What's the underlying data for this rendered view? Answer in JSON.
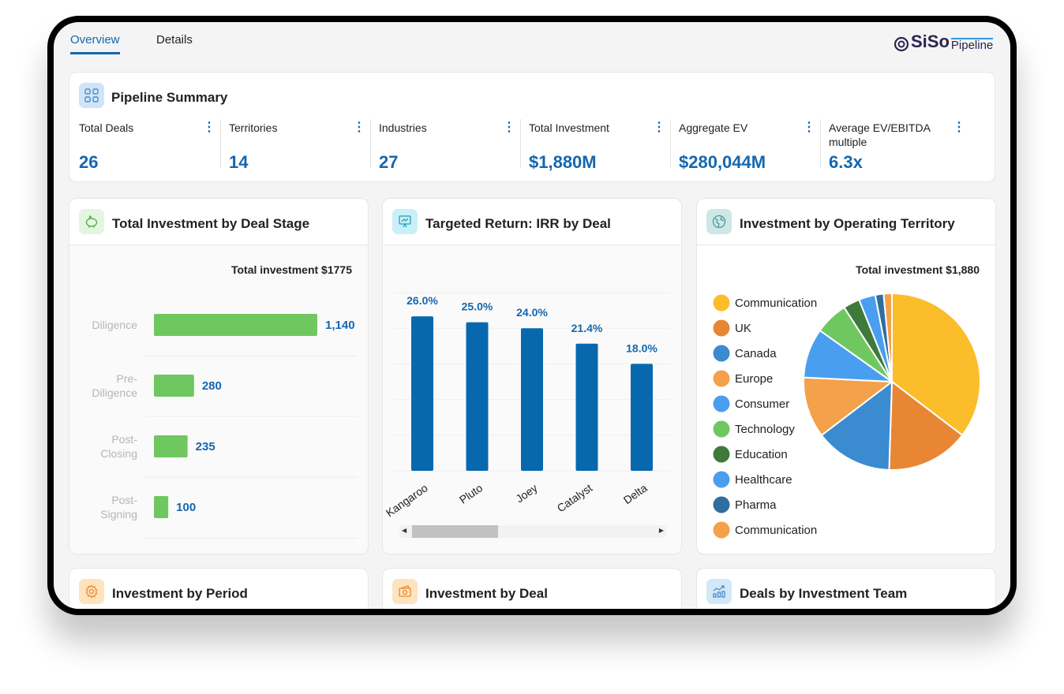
{
  "tabs": [
    {
      "label": "Overview",
      "active": true
    },
    {
      "label": "Details",
      "active": false
    }
  ],
  "logo": {
    "brand": "SiSo",
    "product": "Pipeline"
  },
  "summary": {
    "title": "Pipeline Summary",
    "metrics": [
      {
        "label": "Total Deals",
        "value": "26"
      },
      {
        "label": "Territories",
        "value": "14"
      },
      {
        "label": "Industries",
        "value": "27"
      },
      {
        "label": "Total Investment",
        "value": "$1,880M"
      },
      {
        "label": "Aggregate EV",
        "value": "$280,044M"
      },
      {
        "label": "Average EV/EBITDA multiple",
        "value": "6.3x"
      }
    ]
  },
  "cards": {
    "deal_stage": {
      "title": "Total Investment by Deal Stage",
      "icon": "piggy-bank-icon"
    },
    "irr": {
      "title": "Targeted Return: IRR by Deal",
      "icon": "presentation-chart-icon"
    },
    "territory": {
      "title": "Investment by Operating Territory",
      "icon": "globe-icon"
    },
    "period": {
      "title": "Investment by Period",
      "icon": "gear-icon"
    },
    "deal": {
      "title": "Investment by Deal",
      "icon": "cash-icon"
    },
    "team": {
      "title": "Deals by Investment Team",
      "icon": "bar-chart-icon"
    }
  },
  "chart_data": [
    {
      "type": "bar",
      "orientation": "horizontal",
      "title": "Total investment $1775",
      "categories": [
        "Diligence",
        "Pre-Diligence",
        "Post-Closing",
        "Post-Signing"
      ],
      "category_lines": [
        [
          "Diligence"
        ],
        [
          "Pre-",
          "Diligence"
        ],
        [
          "Post-",
          "Closing"
        ],
        [
          "Post-",
          "Signing"
        ]
      ],
      "values": [
        1140,
        280,
        235,
        100
      ],
      "value_labels": [
        "1,140",
        "280",
        "235",
        "100"
      ],
      "color": "#6fc760",
      "label_color": "#1467b0"
    },
    {
      "type": "bar",
      "categories": [
        "Kangaroo",
        "Pluto",
        "Joey",
        "Catalyst",
        "Delta"
      ],
      "values": [
        26.0,
        25.0,
        24.0,
        21.4,
        18.0
      ],
      "value_labels": [
        "26.0%",
        "25.0%",
        "24.0%",
        "21.4%",
        "18.0%"
      ],
      "ylim": [
        0,
        30
      ],
      "grid": true,
      "color": "#0868ae"
    },
    {
      "type": "pie",
      "title": "Total investment $1,880",
      "legend": "left",
      "labels": [
        "Communication",
        "UK",
        "Canada",
        "Europe",
        "Consumer",
        "Technology",
        "Education",
        "Healthcare",
        "Pharma",
        "Communication"
      ],
      "values": [
        35,
        15,
        14,
        11,
        9,
        6,
        3,
        3,
        1.5,
        1.5
      ],
      "colors": [
        "#fbbd29",
        "#e88634",
        "#3a8bd0",
        "#f3a14a",
        "#4a9ef0",
        "#6fc760",
        "#3f7a3c",
        "#4a9ef0",
        "#2e6ea0",
        "#f3a14a"
      ]
    }
  ]
}
